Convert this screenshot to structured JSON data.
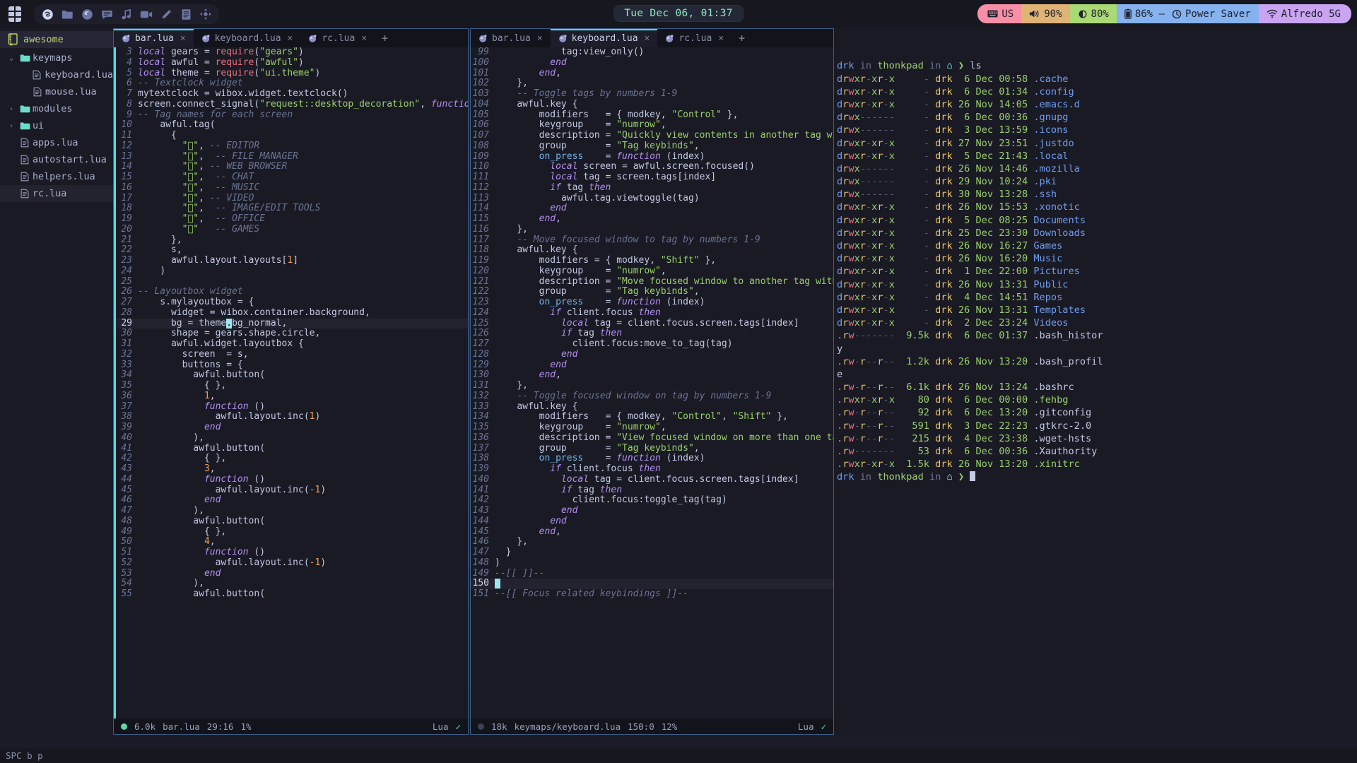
{
  "topbar": {
    "launcher_icon": "grid-apps-icon",
    "taskbar_items": [
      {
        "name": "emacs-icon",
        "label": "Emacs"
      },
      {
        "name": "file-manager-icon",
        "label": "Files"
      },
      {
        "name": "firefox-icon",
        "label": "Firefox"
      },
      {
        "name": "chat-icon",
        "label": "Chat"
      },
      {
        "name": "music-icon",
        "label": "Music"
      },
      {
        "name": "video-icon",
        "label": "Video"
      },
      {
        "name": "edit-pencil-icon",
        "label": "Image/Edit"
      },
      {
        "name": "office-icon",
        "label": "Office"
      },
      {
        "name": "games-icon",
        "label": "Games"
      }
    ],
    "clock": "Tue Dec 06, 01:37",
    "tray": [
      {
        "name": "keyboard-layout",
        "icon": "keyboard-icon",
        "label": "US",
        "bg": "#f98fa6"
      },
      {
        "name": "volume",
        "icon": "speaker-icon",
        "label": "90%",
        "bg": "#e0b474"
      },
      {
        "name": "brightness",
        "icon": "brightness-icon",
        "label": "80%",
        "bg": "#a9da74"
      },
      {
        "name": "battery",
        "icon": "battery-icon",
        "label": "86% –",
        "bg": "#86b2ef"
      },
      {
        "name": "power-profile",
        "icon": "clock-icon",
        "label": "Power Saver",
        "bg": "#86b2ef"
      },
      {
        "name": "wifi",
        "icon": "wifi-icon",
        "label": "Alfredo 5G",
        "bg": "#c9a4f0"
      }
    ]
  },
  "filetree": {
    "root": {
      "label": "awesome",
      "icon": "book-icon"
    },
    "items": [
      {
        "label": "keymaps",
        "type": "dir",
        "chevron": "v",
        "indent": 0,
        "selected": false
      },
      {
        "label": "keyboard.lua",
        "type": "file",
        "chevron": "",
        "indent": 1,
        "selected": false
      },
      {
        "label": "mouse.lua",
        "type": "file",
        "chevron": "",
        "indent": 1,
        "selected": false
      },
      {
        "label": "modules",
        "type": "dir",
        "chevron": ">",
        "indent": 0,
        "selected": false
      },
      {
        "label": "ui",
        "type": "dir",
        "chevron": ">",
        "indent": 0,
        "selected": false
      },
      {
        "label": "apps.lua",
        "type": "file",
        "chevron": "",
        "indent": 0,
        "selected": false
      },
      {
        "label": "autostart.lua",
        "type": "file",
        "chevron": "",
        "indent": 0,
        "selected": false
      },
      {
        "label": "helpers.lua",
        "type": "file",
        "chevron": "",
        "indent": 0,
        "selected": false
      },
      {
        "label": "rc.lua",
        "type": "file",
        "chevron": "",
        "indent": 0,
        "selected": true
      }
    ]
  },
  "editor_left": {
    "tabs": [
      {
        "label": "bar.lua",
        "active": true
      },
      {
        "label": "keyboard.lua",
        "active": false
      },
      {
        "label": "rc.lua",
        "active": false
      }
    ],
    "new_tab_label": "+",
    "close_glyph": "×",
    "first_line_number": 3,
    "highlight_line": 29,
    "lines": [
      "local gears = require(\"gears\")",
      "local awful = require(\"awful\")",
      "local theme = require(\"ui.theme\")",
      "-- Textclock widget",
      "mytextclock = wibox.widget.textclock()",
      "screen.connect_signal(\"request::desktop_decoration\", function(s)",
      "-- Tag names for each screen",
      "    awful.tag(",
      "      {",
      "        \"\", -- EDITOR",
      "        \"\",  -- FILE MANAGER",
      "        \"\", -- WEB BROWSER",
      "        \"\",  -- CHAT",
      "        \"\",  -- MUSIC",
      "        \"\", -- VIDEO",
      "        \"\",  -- IMAGE/EDIT TOOLS",
      "        \"\",  -- OFFICE",
      "        \"\"   -- GAMES",
      "      },",
      "      s,",
      "      awful.layout.layouts[1]",
      "    )",
      "",
      "-- Layoutbox widget",
      "    s.mylayoutbox = {",
      "      widget = wibox.container.background,",
      "      bg = theme.bg_normal,",
      "      shape = gears.shape.circle,",
      "      awful.widget.layoutbox {",
      "        screen  = s,",
      "        buttons = {",
      "          awful.button(",
      "            { },",
      "            1,",
      "            function ()",
      "              awful.layout.inc(1)",
      "            end",
      "          ),",
      "          awful.button(",
      "            { },",
      "            3,",
      "            function ()",
      "              awful.layout.inc(-1)",
      "            end",
      "          ),",
      "          awful.button(",
      "            { },",
      "            4,",
      "            function ()",
      "              awful.layout.inc(-1)",
      "            end",
      "          ),",
      "          awful.button("
    ],
    "statusline": {
      "size": "6.0k",
      "file": "bar.lua",
      "position": "29:16",
      "percent": "1%",
      "filetype": "Lua",
      "check": "✓"
    }
  },
  "editor_right": {
    "tabs": [
      {
        "label": "bar.lua",
        "active": false
      },
      {
        "label": "keyboard.lua",
        "active": true
      },
      {
        "label": "rc.lua",
        "active": false
      }
    ],
    "new_tab_label": "+",
    "close_glyph": "×",
    "first_line_number": 99,
    "lines": [
      "            tag:view_only()",
      "          end",
      "        end,",
      "    },",
      "    -- Toggle tags by numbers 1-9",
      "    awful.key {",
      "        modifiers   = { modkey, \"Control\" },",
      "        keygroup    = \"numrow\",",
      "        description = \"Quickly view contents in another tag with number ›",
      "        group       = \"Tag keybinds\",",
      "        on_press    = function (index)",
      "          local screen = awful.screen.focused()",
      "          local tag = screen.tags[index]",
      "          if tag then",
      "            awful.tag.viewtoggle(tag)",
      "          end",
      "        end,",
      "    },",
      "    -- Move focused window to tag by numbers 1-9",
      "    awful.key {",
      "        modifiers = { modkey, \"Shift\" },",
      "        keygroup    = \"numrow\",",
      "        description = \"Move focused window to another tag with number ke›",
      "        group       = \"Tag keybinds\",",
      "        on_press    = function (index)",
      "          if client.focus then",
      "            local tag = client.focus.screen.tags[index]",
      "            if tag then",
      "              client.focus:move_to_tag(tag)",
      "            end",
      "          end",
      "        end,",
      "    },",
      "    -- Toggle focused window on tag by numbers 1-9",
      "    awful.key {",
      "        modifiers   = { modkey, \"Control\", \"Shift\" },",
      "        keygroup    = \"numrow\",",
      "        description = \"View focused window on more than one tag with num›",
      "        group       = \"Tag keybinds\",",
      "        on_press    = function (index)",
      "          if client.focus then",
      "            local tag = client.focus.screen.tags[index]",
      "            if tag then",
      "              client.focus:toggle_tag(tag)",
      "            end",
      "          end",
      "        end,",
      "    },",
      "  }",
      ")",
      "--[[ ]]--",
      "",
      "--[[ Focus related keybindings ]]--"
    ],
    "highlight_line": 150,
    "statusline": {
      "size": "18k",
      "file": "keymaps/keyboard.lua",
      "position": "150:0",
      "percent": "12%",
      "filetype": "Lua",
      "check": "✓"
    }
  },
  "terminal": {
    "prompt_top": {
      "user": "drk",
      "in_word": "in",
      "host": "thonkpad",
      "in2": "in",
      "home_icon": "",
      "arrow": "❯",
      "command": "ls"
    },
    "entries": [
      {
        "perm": "drwxr-xr-x",
        "size": "-",
        "owner": "drk",
        "day": "6",
        "month": "Dec",
        "time": "00:58",
        "name": ".cache",
        "kind": "dir"
      },
      {
        "perm": "drwxr-xr-x",
        "size": "-",
        "owner": "drk",
        "day": "6",
        "month": "Dec",
        "time": "01:34",
        "name": ".config",
        "kind": "dir"
      },
      {
        "perm": "drwxr-xr-x",
        "size": "-",
        "owner": "drk",
        "day": "26",
        "month": "Nov",
        "time": "14:05",
        "name": ".emacs.d",
        "kind": "dir"
      },
      {
        "perm": "drwx------",
        "size": "-",
        "owner": "drk",
        "day": "6",
        "month": "Dec",
        "time": "00:36",
        "name": ".gnupg",
        "kind": "dir"
      },
      {
        "perm": "drwx------",
        "size": "-",
        "owner": "drk",
        "day": "3",
        "month": "Dec",
        "time": "13:59",
        "name": ".icons",
        "kind": "dir"
      },
      {
        "perm": "drwxr-xr-x",
        "size": "-",
        "owner": "drk",
        "day": "27",
        "month": "Nov",
        "time": "23:51",
        "name": ".justdo",
        "kind": "dir"
      },
      {
        "perm": "drwxr-xr-x",
        "size": "-",
        "owner": "drk",
        "day": "5",
        "month": "Dec",
        "time": "21:43",
        "name": ".local",
        "kind": "dir"
      },
      {
        "perm": "drwx------",
        "size": "-",
        "owner": "drk",
        "day": "26",
        "month": "Nov",
        "time": "14:46",
        "name": ".mozilla",
        "kind": "dir"
      },
      {
        "perm": "drwx------",
        "size": "-",
        "owner": "drk",
        "day": "29",
        "month": "Nov",
        "time": "10:24",
        "name": ".pki",
        "kind": "dir"
      },
      {
        "perm": "drwx------",
        "size": "-",
        "owner": "drk",
        "day": "30",
        "month": "Nov",
        "time": "13:28",
        "name": ".ssh",
        "kind": "dir"
      },
      {
        "perm": "drwxr-xr-x",
        "size": "-",
        "owner": "drk",
        "day": "26",
        "month": "Nov",
        "time": "15:53",
        "name": ".xonotic",
        "kind": "dir"
      },
      {
        "perm": "drwxr-xr-x",
        "size": "-",
        "owner": "drk",
        "day": "5",
        "month": "Dec",
        "time": "08:25",
        "name": "Documents",
        "kind": "dir"
      },
      {
        "perm": "drwxr-xr-x",
        "size": "-",
        "owner": "drk",
        "day": "25",
        "month": "Dec",
        "time": "23:30",
        "name": "Downloads",
        "kind": "dir"
      },
      {
        "perm": "drwxr-xr-x",
        "size": "-",
        "owner": "drk",
        "day": "26",
        "month": "Nov",
        "time": "16:27",
        "name": "Games",
        "kind": "dir"
      },
      {
        "perm": "drwxr-xr-x",
        "size": "-",
        "owner": "drk",
        "day": "26",
        "month": "Nov",
        "time": "16:20",
        "name": "Music",
        "kind": "dir"
      },
      {
        "perm": "drwxr-xr-x",
        "size": "-",
        "owner": "drk",
        "day": "1",
        "month": "Dec",
        "time": "22:00",
        "name": "Pictures",
        "kind": "dir"
      },
      {
        "perm": "drwxr-xr-x",
        "size": "-",
        "owner": "drk",
        "day": "26",
        "month": "Nov",
        "time": "13:31",
        "name": "Public",
        "kind": "dir"
      },
      {
        "perm": "drwxr-xr-x",
        "size": "-",
        "owner": "drk",
        "day": "4",
        "month": "Dec",
        "time": "14:51",
        "name": "Repos",
        "kind": "dir"
      },
      {
        "perm": "drwxr-xr-x",
        "size": "-",
        "owner": "drk",
        "day": "26",
        "month": "Nov",
        "time": "13:31",
        "name": "Templates",
        "kind": "dir"
      },
      {
        "perm": "drwxr-xr-x",
        "size": "-",
        "owner": "drk",
        "day": "2",
        "month": "Dec",
        "time": "23:24",
        "name": "Videos",
        "kind": "dir"
      },
      {
        "perm": ".rw-------",
        "size": "9.5k",
        "owner": "drk",
        "day": "6",
        "month": "Dec",
        "time": "01:37",
        "name": ".bash_histor",
        "kind": "file",
        "wrap": "y"
      },
      {
        "perm": ".rw-r--r--",
        "size": "1.2k",
        "owner": "drk",
        "day": "26",
        "month": "Nov",
        "time": "13:20",
        "name": ".bash_profil",
        "kind": "file",
        "wrap": "e"
      },
      {
        "perm": ".rw-r--r--",
        "size": "6.1k",
        "owner": "drk",
        "day": "26",
        "month": "Nov",
        "time": "13:24",
        "name": ".bashrc",
        "kind": "file"
      },
      {
        "perm": ".rwxr-xr-x",
        "size": "80",
        "owner": "drk",
        "day": "6",
        "month": "Dec",
        "time": "00:00",
        "name": ".fehbg",
        "kind": "exe"
      },
      {
        "perm": ".rw-r--r--",
        "size": "92",
        "owner": "drk",
        "day": "6",
        "month": "Dec",
        "time": "13:20",
        "name": ".gitconfig",
        "kind": "file"
      },
      {
        "perm": ".rw-r--r--",
        "size": "591",
        "owner": "drk",
        "day": "3",
        "month": "Dec",
        "time": "22:23",
        "name": ".gtkrc-2.0",
        "kind": "file"
      },
      {
        "perm": ".rw-r--r--",
        "size": "215",
        "owner": "drk",
        "day": "4",
        "month": "Dec",
        "time": "23:38",
        "name": ".wget-hsts",
        "kind": "file"
      },
      {
        "perm": ".rw-------",
        "size": "53",
        "owner": "drk",
        "day": "6",
        "month": "Dec",
        "time": "00:36",
        "name": ".Xauthority",
        "kind": "file"
      },
      {
        "perm": ".rwxr-xr-x",
        "size": "1.5k",
        "owner": "drk",
        "day": "26",
        "month": "Nov",
        "time": "13:20",
        "name": ".xinitrc",
        "kind": "exe"
      }
    ],
    "prompt_bottom": {
      "user": "drk",
      "in_word": "in",
      "host": "thonkpad",
      "in2": "in",
      "home_icon": "",
      "arrow": "❯"
    }
  },
  "bottombar": {
    "text": "SPC b p"
  }
}
